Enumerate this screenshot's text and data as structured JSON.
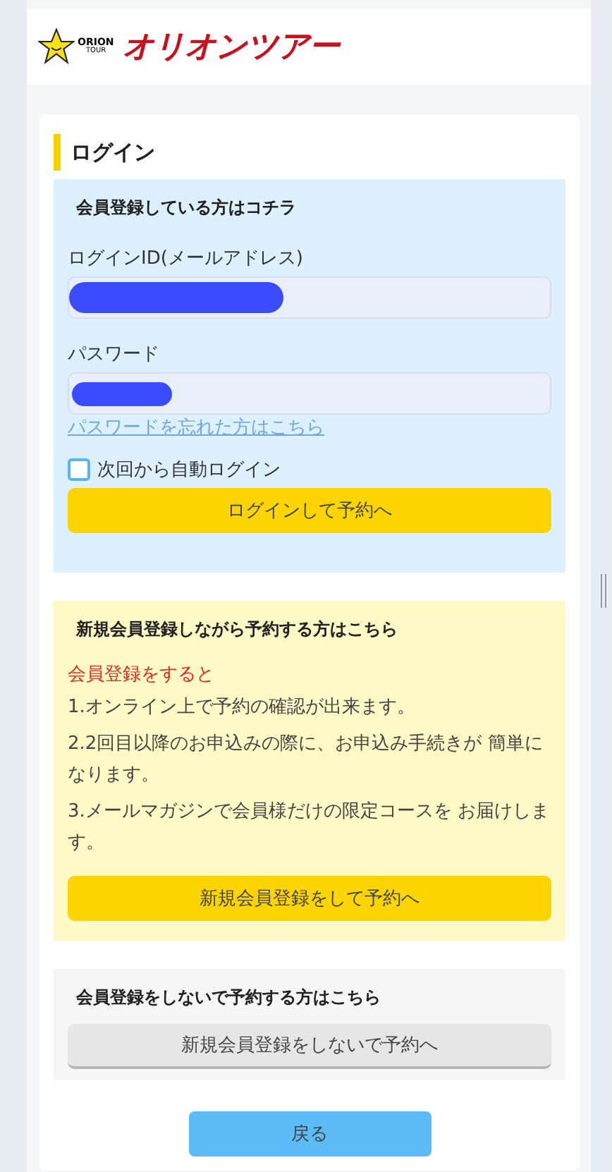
{
  "header": {
    "logo_text": [
      "ORION",
      "TOUR"
    ],
    "brand": "オリオンツアー"
  },
  "login": {
    "title": "ログイン",
    "member_section": {
      "heading": "会員登録している方はコチラ",
      "fields": [
        {
          "label": "ログインID(メールアドレス)",
          "redacted": true,
          "kind": "text"
        },
        {
          "label": "パスワード",
          "redacted": true,
          "kind": "password"
        }
      ],
      "forgot_link": "パスワードを忘れた方はこちら",
      "auto_login": {
        "label": "次回から自動ログイン",
        "checked": false
      },
      "button": "ログインして予約へ"
    },
    "register_section": {
      "heading": "新規会員登録しながら予約する方はこちら",
      "lead": "会員登録をすると",
      "benefits": [
        "1.オンライン上で予約の確認が出来ます。",
        "2.2回目以降のお申込みの際に、お申込み手続きが 簡単になります。",
        "3.メールマガジンで会員様だけの限定コースを お届けします。"
      ],
      "button": "新規会員登録をして予約へ"
    },
    "guest_section": {
      "heading": "会員登録をしないで予約する方はこちら",
      "button": "新規会員登録をしないで予約へ"
    },
    "back_button": "戻る"
  }
}
